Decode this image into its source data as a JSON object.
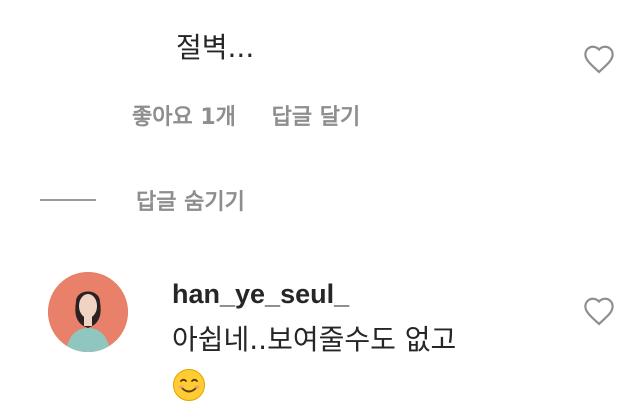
{
  "comment": {
    "text": "절벽..."
  },
  "meta": {
    "likes_label": "좋아요 1개",
    "reply_label": "답글 달기"
  },
  "replies_toggle": {
    "label": "답글 숨기기"
  },
  "reply": {
    "username": "han_ye_seul_",
    "text": "아쉽네..보여줄수도 없고",
    "emoji": "smiling-face-emoji"
  },
  "colors": {
    "text": "#262626",
    "secondary": "#8e8e8e",
    "avatar_bg": "#e8806a"
  }
}
